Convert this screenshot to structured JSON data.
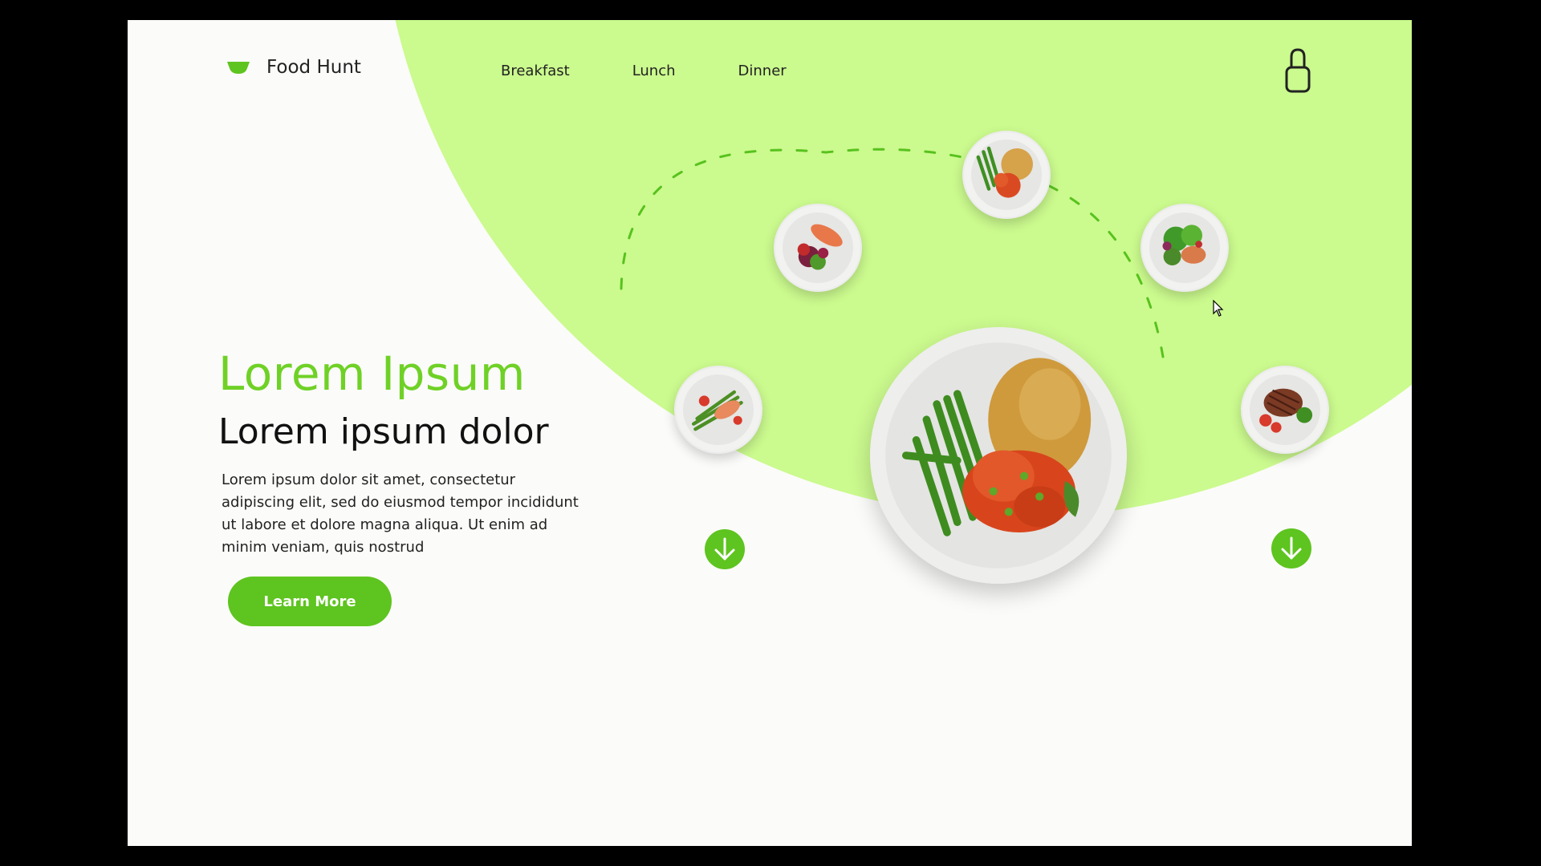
{
  "brand": {
    "name": "Food Hunt",
    "icon": "bowl-icon"
  },
  "nav": {
    "items": [
      {
        "label": "Breakfast"
      },
      {
        "label": "Lunch"
      },
      {
        "label": "Dinner"
      }
    ]
  },
  "header": {
    "lock_icon": "lock-icon"
  },
  "hero": {
    "title": "Lorem Ipsum",
    "subtitle": "Lorem ipsum dolor",
    "body": "Lorem ipsum dolor sit amet, consectetur adipiscing elit, sed do eiusmod tempor incididunt ut labore et dolore magna aliqua. Ut enim ad minim veniam, quis nostrud",
    "cta_label": "Learn More"
  },
  "carousel": {
    "dishes": [
      {
        "name": "salmon-salad-dish"
      },
      {
        "name": "salmon-asparagus-dish"
      },
      {
        "name": "chicken-rice-dish"
      },
      {
        "name": "green-salad-dish"
      },
      {
        "name": "steak-dish"
      }
    ],
    "featured": {
      "name": "chicken-green-beans-rice-dish"
    },
    "left_arrow_icon": "arrow-down-icon",
    "right_arrow_icon": "arrow-down-icon"
  },
  "colors": {
    "accent": "#5ec41f",
    "title_green": "#6fd126",
    "blob": "#cbfa8e",
    "background": "#fbfbf9"
  }
}
